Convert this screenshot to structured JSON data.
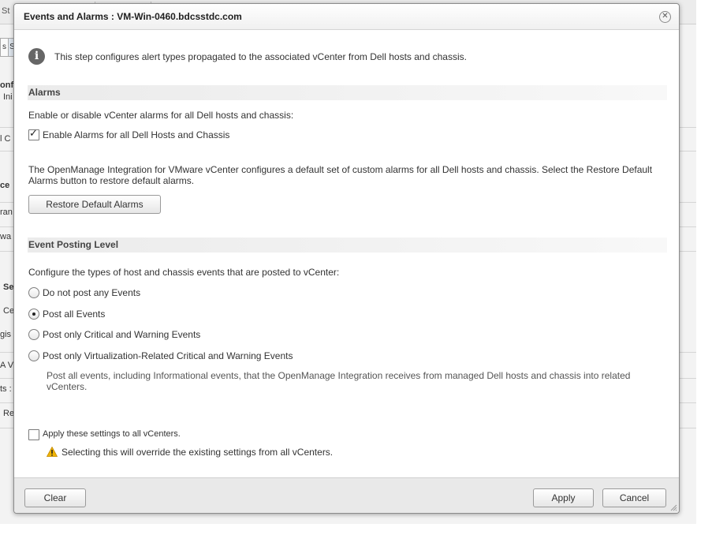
{
  "background": {
    "top_fragment": "St",
    "tabs": [
      "s",
      "S"
    ],
    "fragments": [
      {
        "text": "onf",
        "bold": true
      },
      {
        "text": "Ini",
        "bold": false
      },
      {
        "text": "l C",
        "bold": false
      },
      {
        "text": "ce",
        "bold": true
      },
      {
        "text": "ran",
        "bold": false
      },
      {
        "text": "wa",
        "bold": false
      },
      {
        "text": "Se",
        "bold": true
      },
      {
        "text": "Ce",
        "bold": false
      },
      {
        "text": "gis",
        "bold": false
      },
      {
        "text": "A V",
        "bold": false
      },
      {
        "text": "ts :",
        "bold": false
      },
      {
        "text": "Re",
        "bold": false
      }
    ]
  },
  "dialog": {
    "title": "Events and Alarms : VM-Win-0460.bdcsstdc.com",
    "close_icon": "close-icon",
    "info_text": "This step configures alert types propagated to the associated vCenter from Dell hosts and chassis.",
    "alarms": {
      "heading": "Alarms",
      "description": "Enable or disable vCenter alarms for all Dell hosts and chassis:",
      "enable_label": "Enable Alarms for all Dell Hosts and Chassis",
      "enable_checked": true,
      "default_text": "The OpenManage Integration for VMware vCenter configures a default set of custom alarms for all Dell hosts and chassis. Select the Restore Default Alarms button to restore default alarms.",
      "restore_button": "Restore Default Alarms"
    },
    "event_posting": {
      "heading": "Event Posting Level",
      "description": "Configure the types of host and chassis events that are posted to vCenter:",
      "options": [
        {
          "label": "Do not post any Events",
          "checked": false
        },
        {
          "label": "Post all Events",
          "checked": true
        },
        {
          "label": "Post only Critical and Warning Events",
          "checked": false
        },
        {
          "label": "Post only Virtualization-Related Critical and Warning Events",
          "checked": false
        }
      ],
      "option_help": "Post all events, including Informational events, that the OpenManage Integration receives from managed Dell hosts and chassis into related vCenters."
    },
    "apply_all": {
      "label": "Apply these settings to all vCenters.",
      "checked": false,
      "warning": "Selecting this will override the existing settings from all vCenters."
    },
    "footer": {
      "clear_button": "Clear",
      "apply_button": "Apply",
      "cancel_button": "Cancel"
    }
  },
  "colors": {
    "warning_icon": "#f0b400",
    "section_header_bg": "#ebebeb",
    "footer_bg": "#e9e9e9"
  }
}
